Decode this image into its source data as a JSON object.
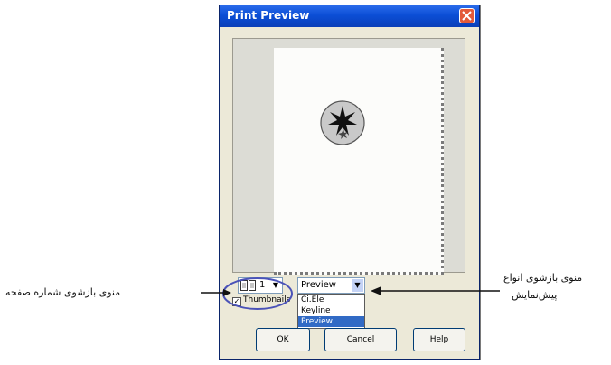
{
  "dialog": {
    "title": "Print Preview"
  },
  "controls": {
    "page_number": "1",
    "mode_selected": "Preview",
    "mode_options": [
      "Ci.Ele",
      "Keyline",
      "Preview"
    ],
    "thumbnails_label": "Thumbnails",
    "thumbnails_checked": true
  },
  "buttons": {
    "ok": "OK",
    "cancel": "Cancel",
    "help": "Help"
  },
  "annotations": {
    "page_number_list": "منوی بازشوی شماره صفحه",
    "preview_types_line1": "منوی بازشوی انواع",
    "preview_types_line2": "پیش‌نمایش"
  },
  "icons": {
    "close": "close-icon",
    "page": "page-spin-icon",
    "clipart": "star-clipart-icon",
    "dropdown": "chevron-down-icon"
  }
}
